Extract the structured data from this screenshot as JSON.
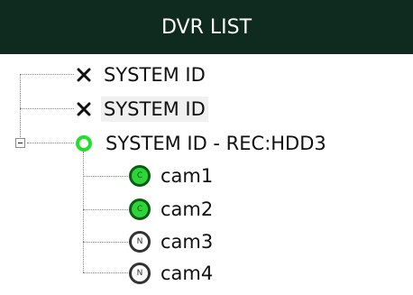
{
  "header": {
    "title": "DVR LIST"
  },
  "tree": {
    "nodes": [
      {
        "label": "SYSTEM ID",
        "status_icon": "x-icon",
        "selected": false
      },
      {
        "label": "SYSTEM ID",
        "status_icon": "x-icon",
        "selected": true
      },
      {
        "label": "SYSTEM ID - REC:HDD3",
        "status_icon": "green-ring-icon",
        "expanded": true,
        "children": [
          {
            "label": "cam1",
            "state_letter": "C",
            "icon": "camera-connected-icon"
          },
          {
            "label": "cam2",
            "state_letter": "C",
            "icon": "camera-connected-icon"
          },
          {
            "label": "cam3",
            "state_letter": "N",
            "icon": "camera-none-icon"
          },
          {
            "label": "cam4",
            "state_letter": "N",
            "icon": "camera-none-icon"
          }
        ]
      }
    ]
  },
  "colors": {
    "header_bg": "#0f2b1f",
    "header_text": "#ffffff",
    "connected_green": "#2ed43a",
    "ring_green": "#22e02a"
  }
}
